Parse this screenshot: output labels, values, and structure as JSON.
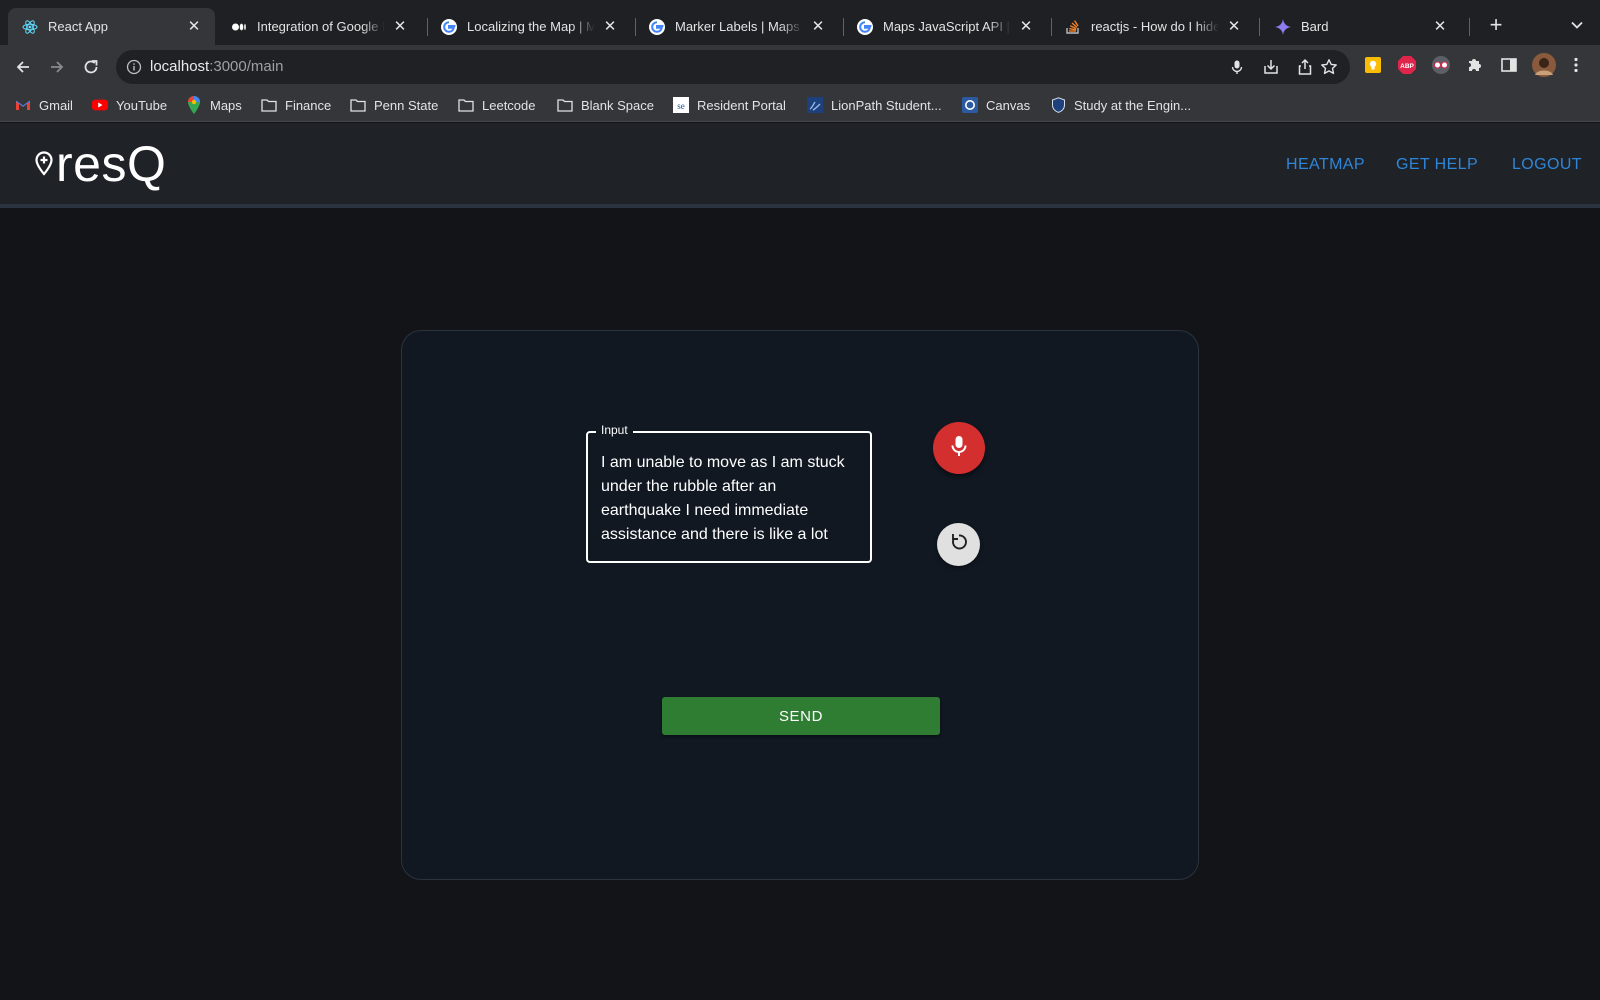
{
  "browser": {
    "tabs": [
      {
        "title": "React App",
        "icon": "react-icon"
      },
      {
        "title": "Integration of Google M",
        "icon": "medium-icon"
      },
      {
        "title": "Localizing the Map  |  M",
        "icon": "google-icon"
      },
      {
        "title": "Marker Labels  |  Maps",
        "icon": "google-icon"
      },
      {
        "title": "Maps JavaScript API  |",
        "icon": "google-icon"
      },
      {
        "title": "reactjs - How do I hide",
        "icon": "stackoverflow-icon"
      },
      {
        "title": "Bard",
        "icon": "bard-icon"
      }
    ],
    "tab_close_glyph": "✕",
    "new_tab_glyph": "+",
    "address": {
      "host": "localhost",
      "path": ":3000/main"
    },
    "bookmarks": [
      {
        "label": "Gmail",
        "icon": "gmail-icon"
      },
      {
        "label": "YouTube",
        "icon": "youtube-icon"
      },
      {
        "label": "Maps",
        "icon": "maps-icon"
      },
      {
        "label": "Finance",
        "icon": "folder-icon"
      },
      {
        "label": "Penn State",
        "icon": "folder-icon"
      },
      {
        "label": "Leetcode",
        "icon": "folder-icon"
      },
      {
        "label": "Blank Space",
        "icon": "folder-icon"
      },
      {
        "label": "Resident Portal",
        "icon": "resident-portal-icon"
      },
      {
        "label": "LionPath Student...",
        "icon": "lionpath-icon"
      },
      {
        "label": "Canvas",
        "icon": "canvas-icon"
      },
      {
        "label": "Study at the Engin...",
        "icon": "shield-icon"
      }
    ]
  },
  "app": {
    "logo_text": "resQ",
    "nav": [
      {
        "label": "HEATMAP"
      },
      {
        "label": "GET HELP"
      },
      {
        "label": "LOGOUT"
      }
    ],
    "input": {
      "label": "Input",
      "value": "I am unable to move as I am stuck under the rubble after an earthquake I need immediate assistance and there is like a lot"
    },
    "send_label": "SEND",
    "colors": {
      "accent_link": "#2f86d9",
      "mic_button": "#d32f2f",
      "send_button": "#2e7d32",
      "card_bg": "#111822",
      "page_bg": "#121418"
    }
  }
}
